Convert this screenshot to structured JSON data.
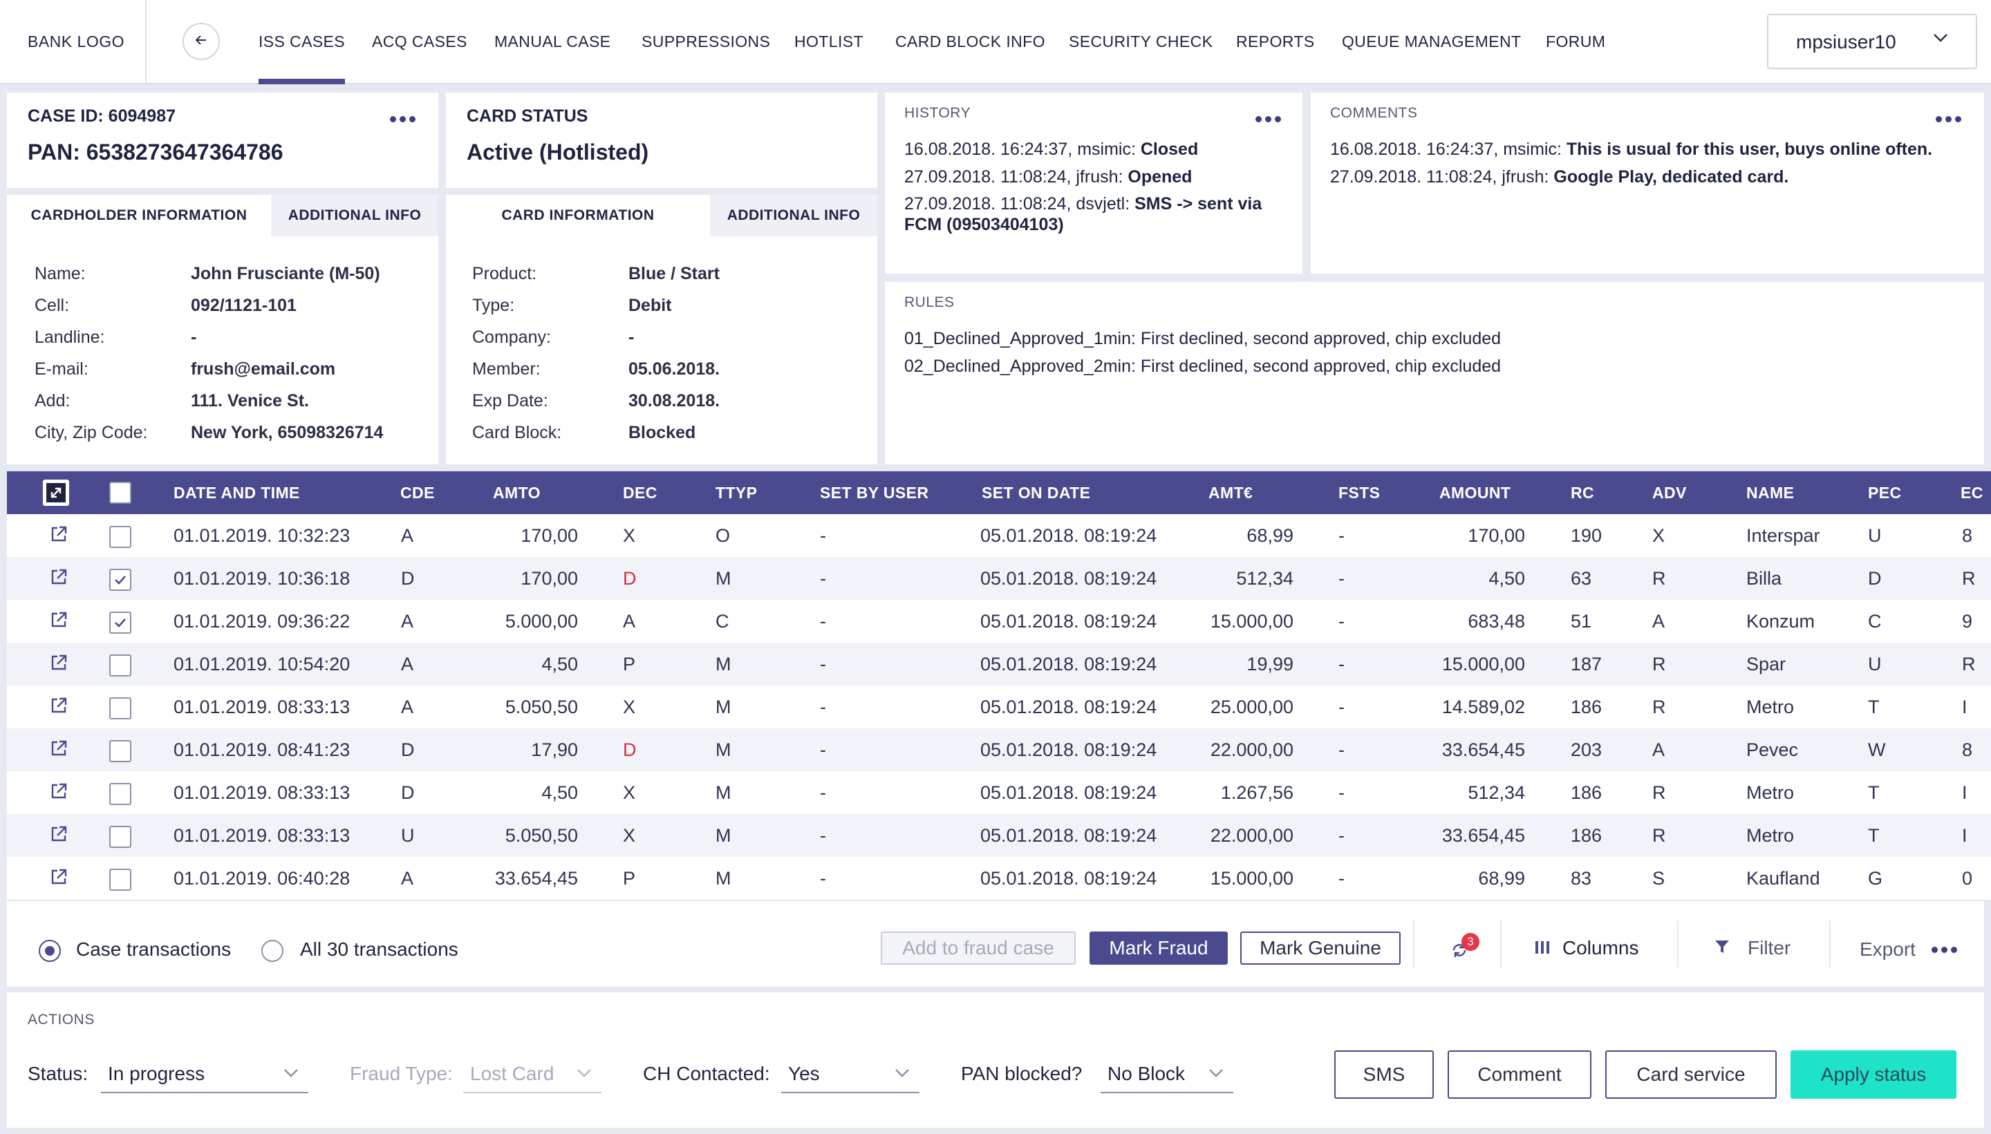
{
  "nav": {
    "logo": "BANK LOGO",
    "tabs": [
      "ISS CASES",
      "ACQ CASES",
      "MANUAL CASE",
      "SUPPRESSIONS",
      "HOTLIST",
      "CARD BLOCK INFO",
      "SECURITY CHECK",
      "REPORTS",
      "QUEUE MANAGEMENT",
      "FORUM"
    ],
    "active_tab": "ISS CASES",
    "user": "mpsiuser10"
  },
  "case": {
    "id_label": "CASE ID: 6094987",
    "pan_label": "PAN: 6538273647364786"
  },
  "card_status": {
    "label": "CARD STATUS",
    "value": "Active (Hotlisted)"
  },
  "history": {
    "label": "HISTORY",
    "entries": [
      {
        "meta": "16.08.2018. 16:24:37, msimic: ",
        "text": "Closed"
      },
      {
        "meta": "27.09.2018. 11:08:24, jfrush: ",
        "text": "Opened"
      },
      {
        "meta": "27.09.2018. 11:08:24, dsvjetl: ",
        "text": "SMS -> sent via FCM (09503404103)"
      }
    ]
  },
  "comments": {
    "label": "COMMENTS",
    "entries": [
      {
        "meta": "16.08.2018. 16:24:37, msimic: ",
        "text": "This is usual for this user, buys online often."
      },
      {
        "meta": "27.09.2018. 11:08:24, jfrush: ",
        "text": "Google Play, dedicated card."
      }
    ]
  },
  "rules": {
    "label": "RULES",
    "items": [
      "01_Declined_Approved_1min: First declined, second approved, chip excluded",
      "02_Declined_Approved_2min: First declined, second approved, chip excluded"
    ]
  },
  "cardholder": {
    "tabs": [
      "CARDHOLDER INFORMATION",
      "ADDITIONAL INFO"
    ],
    "fields": [
      {
        "k": "Name:",
        "v": "John Frusciante (M-50)"
      },
      {
        "k": "Cell:",
        "v": "092/1121-101"
      },
      {
        "k": "Landline:",
        "v": "-"
      },
      {
        "k": "E-mail:",
        "v": "frush@email.com"
      },
      {
        "k": "Add:",
        "v": "111. Venice St."
      },
      {
        "k": "City, Zip Code:",
        "v": "New York, 65098326714"
      }
    ]
  },
  "card_info": {
    "tabs": [
      "CARD INFORMATION",
      "ADDITIONAL INFO"
    ],
    "fields": [
      {
        "k": "Product:",
        "v": "Blue / Start"
      },
      {
        "k": "Type:",
        "v": "Debit"
      },
      {
        "k": "Company:",
        "v": "-"
      },
      {
        "k": "Member:",
        "v": "05.06.2018."
      },
      {
        "k": "Exp Date:",
        "v": "30.08.2018."
      },
      {
        "k": "Card Block:",
        "v": "Blocked"
      }
    ]
  },
  "table": {
    "columns": [
      "DATE AND TIME",
      "CDE",
      "AMTO",
      "DEC",
      "TTYP",
      "SET BY USER",
      "SET ON DATE",
      "AMT€",
      "FSTS",
      "AMOUNT",
      "RC",
      "ADV",
      "NAME",
      "PEC",
      "EC"
    ],
    "rows": [
      {
        "checked": false,
        "date": "01.01.2019. 10:32:23",
        "cde": "A",
        "amto": "170,00",
        "dec": "X",
        "dec_red": false,
        "ttyp": "O",
        "setby": "-",
        "seton": "05.01.2018. 08:19:24",
        "amte": "68,99",
        "fsts": "-",
        "amount": "170,00",
        "rc": "190",
        "adv": "X",
        "name": "Interspar",
        "pec": "U",
        "ec": "8"
      },
      {
        "checked": true,
        "date": "01.01.2019. 10:36:18",
        "cde": "D",
        "amto": "170,00",
        "dec": "D",
        "dec_red": true,
        "ttyp": "M",
        "setby": "-",
        "seton": "05.01.2018. 08:19:24",
        "amte": "512,34",
        "fsts": "-",
        "amount": "4,50",
        "rc": "63",
        "adv": "R",
        "name": "Billa",
        "pec": "D",
        "ec": "R"
      },
      {
        "checked": true,
        "date": "01.01.2019. 09:36:22",
        "cde": "A",
        "amto": "5.000,00",
        "dec": "A",
        "dec_red": false,
        "ttyp": "C",
        "setby": "-",
        "seton": "05.01.2018. 08:19:24",
        "amte": "15.000,00",
        "fsts": "-",
        "amount": "683,48",
        "rc": "51",
        "adv": "A",
        "name": "Konzum",
        "pec": "C",
        "ec": "9"
      },
      {
        "checked": false,
        "date": "01.01.2019. 10:54:20",
        "cde": "A",
        "amto": "4,50",
        "dec": "P",
        "dec_red": false,
        "ttyp": "M",
        "setby": "-",
        "seton": "05.01.2018. 08:19:24",
        "amte": "19,99",
        "fsts": "-",
        "amount": "15.000,00",
        "rc": "187",
        "adv": "R",
        "name": "Spar",
        "pec": "U",
        "ec": "R"
      },
      {
        "checked": false,
        "date": "01.01.2019. 08:33:13",
        "cde": "A",
        "amto": "5.050,50",
        "dec": "X",
        "dec_red": false,
        "ttyp": "M",
        "setby": "-",
        "seton": "05.01.2018. 08:19:24",
        "amte": "25.000,00",
        "fsts": "-",
        "amount": "14.589,02",
        "rc": "186",
        "adv": "R",
        "name": "Metro",
        "pec": "T",
        "ec": "I"
      },
      {
        "checked": false,
        "date": "01.01.2019. 08:41:23",
        "cde": "D",
        "amto": "17,90",
        "dec": "D",
        "dec_red": true,
        "ttyp": "M",
        "setby": "-",
        "seton": "05.01.2018. 08:19:24",
        "amte": "22.000,00",
        "fsts": "-",
        "amount": "33.654,45",
        "rc": "203",
        "adv": "A",
        "name": "Pevec",
        "pec": "W",
        "ec": "8"
      },
      {
        "checked": false,
        "date": "01.01.2019. 08:33:13",
        "cde": "D",
        "amto": "4,50",
        "dec": "X",
        "dec_red": false,
        "ttyp": "M",
        "setby": "-",
        "seton": "05.01.2018. 08:19:24",
        "amte": "1.267,56",
        "fsts": "-",
        "amount": "512,34",
        "rc": "186",
        "adv": "R",
        "name": "Metro",
        "pec": "T",
        "ec": "I"
      },
      {
        "checked": false,
        "date": "01.01.2019. 08:33:13",
        "cde": "U",
        "amto": "5.050,50",
        "dec": "X",
        "dec_red": false,
        "ttyp": "M",
        "setby": "-",
        "seton": "05.01.2018. 08:19:24",
        "amte": "22.000,00",
        "fsts": "-",
        "amount": "33.654,45",
        "rc": "186",
        "adv": "R",
        "name": "Metro",
        "pec": "T",
        "ec": "I"
      },
      {
        "checked": false,
        "date": "01.01.2019. 06:40:28",
        "cde": "A",
        "amto": "33.654,45",
        "dec": "P",
        "dec_red": false,
        "ttyp": "M",
        "setby": "-",
        "seton": "05.01.2018. 08:19:24",
        "amte": "15.000,00",
        "fsts": "-",
        "amount": "68,99",
        "rc": "83",
        "adv": "S",
        "name": "Kaufland",
        "pec": "G",
        "ec": "0"
      }
    ]
  },
  "footer": {
    "radio_case": "Case transactions",
    "radio_all": "All 30 transactions",
    "add_fraud": "Add to fraud case",
    "mark_fraud": "Mark Fraud",
    "mark_genuine": "Mark Genuine",
    "refresh_badge": "3",
    "columns": "Columns",
    "filter": "Filter",
    "export": "Export"
  },
  "actions": {
    "label": "ACTIONS",
    "status_label": "Status:",
    "status_value": "In progress",
    "fraud_type_label": "Fraud Type:",
    "fraud_type_value": "Lost Card",
    "ch_contacted_label": "CH Contacted:",
    "ch_contacted_value": "Yes",
    "pan_blocked_label": "PAN blocked?",
    "pan_blocked_value": "No Block",
    "sms": "SMS",
    "comment": "Comment",
    "card_service": "Card service",
    "apply_status": "Apply status"
  },
  "colors": {
    "primary": "#4b4a8f",
    "accent": "#1ee3c8",
    "danger": "#d9303b",
    "background": "#e6e9f2"
  }
}
